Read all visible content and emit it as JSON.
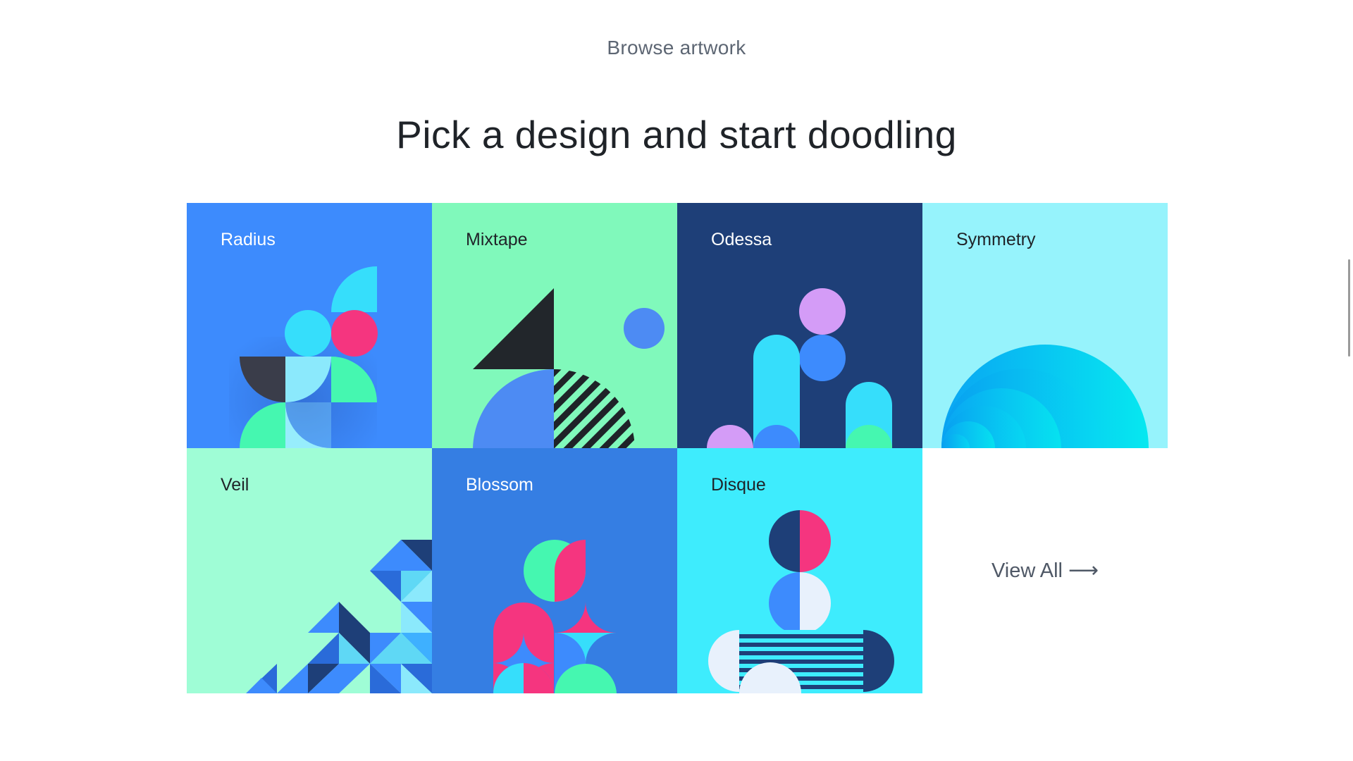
{
  "header": {
    "eyebrow": "Browse artwork",
    "headline": "Pick a design and start doodling"
  },
  "tiles": [
    {
      "title": "Radius",
      "bg": "#3d8bfd",
      "title_color": "#ffffff"
    },
    {
      "title": "Mixtape",
      "bg": "#80f9bb",
      "title_color": "#1f2328"
    },
    {
      "title": "Odessa",
      "bg": "#1e3f78",
      "title_color": "#ffffff"
    },
    {
      "title": "Symmetry",
      "bg": "#96f3fc",
      "title_color": "#1f2328"
    },
    {
      "title": "Veil",
      "bg": "#9ffdd6",
      "title_color": "#1f2328"
    },
    {
      "title": "Blossom",
      "bg": "#357ee3",
      "title_color": "#ffffff"
    },
    {
      "title": "Disque",
      "bg": "#3eecfd",
      "title_color": "#1f2328"
    }
  ],
  "view_all": {
    "label": "View All",
    "arrow": "⟶"
  }
}
